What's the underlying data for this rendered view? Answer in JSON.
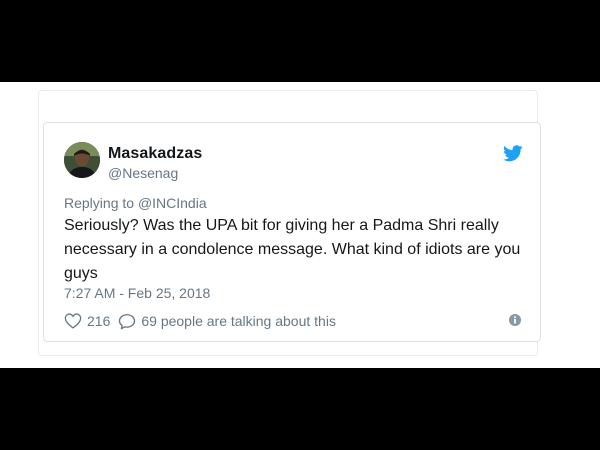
{
  "tweet": {
    "author": {
      "display_name": "Masakadzas",
      "handle": "@Nesenag",
      "avatar_icon": "user-avatar"
    },
    "logo_icon": "twitter-bird-icon",
    "replying_to_prefix": "Replying to",
    "replying_to_handle": "@INCIndia",
    "text": "Seriously? Was the UPA bit for giving her a Padma Shri really necessary in a condolence message. What kind of idiots are you guys",
    "timestamp": "7:27 AM - Feb 25, 2018",
    "likes": "216",
    "talking_text": "69 people are talking about this",
    "icons": {
      "like": "heart-icon",
      "comment": "comment-icon",
      "info": "info-icon"
    },
    "colors": {
      "text": "#14171a",
      "muted": "#657786",
      "brand": "#1da1f2",
      "border": "#dfe3e6"
    }
  }
}
